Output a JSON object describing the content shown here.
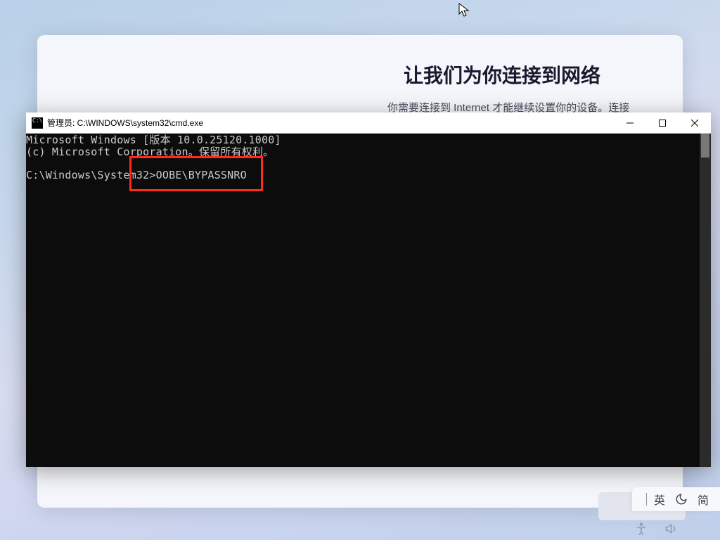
{
  "oobe": {
    "title": "让我们为你连接到网络",
    "subtitle": "你需要连接到 Internet 才能继续设置你的设备。连接"
  },
  "cmd": {
    "title_prefix": "管理员: ",
    "title_path": "C:\\WINDOWS\\system32\\cmd.exe",
    "line1": "Microsoft Windows [版本 10.0.25120.1000]",
    "line2": "(c) Microsoft Corporation。保留所有权利。",
    "prompt": "C:\\Windows\\System32>",
    "command": "OOBE\\BYPASSNRO"
  },
  "ime": {
    "lang": "英",
    "mode": "简"
  }
}
